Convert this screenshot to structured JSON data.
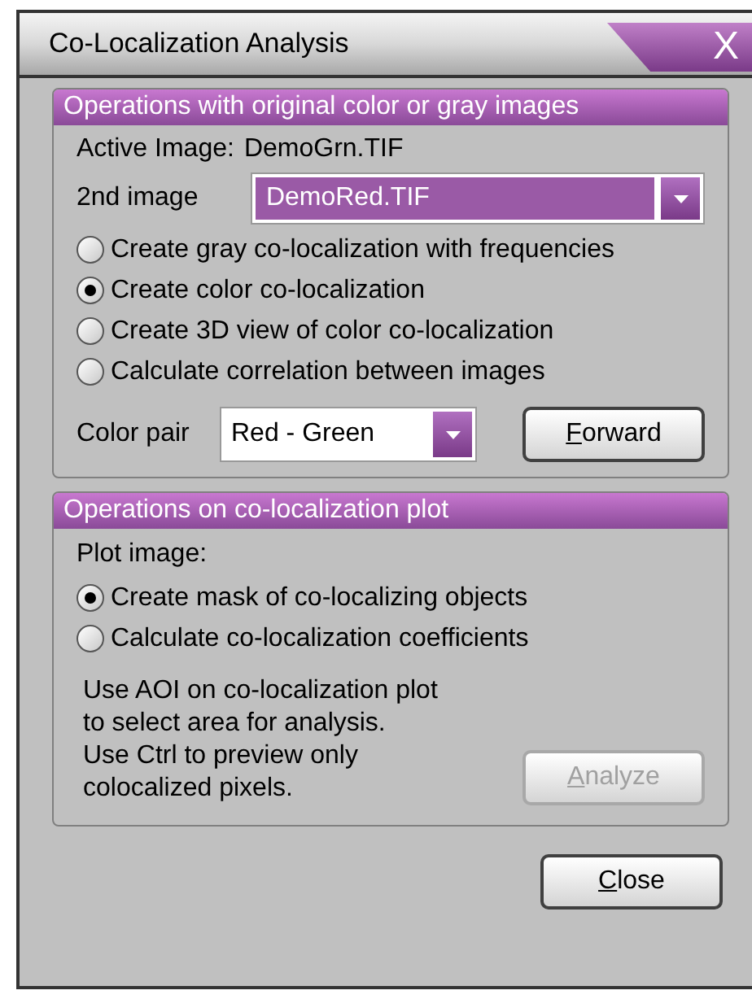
{
  "window": {
    "title": "Co-Localization Analysis",
    "close_glyph": "X"
  },
  "original_group": {
    "header": "Operations with original color or gray images",
    "active_image": {
      "label": "Active Image:",
      "value": "DemoGrn.TIF"
    },
    "second_image": {
      "label": "2nd image",
      "value": "DemoRed.TIF"
    },
    "options": [
      {
        "label": "Create gray co-localization with frequencies",
        "selected": false
      },
      {
        "label": "Create color co-localization",
        "selected": true
      },
      {
        "label": "Create 3D view of color co-localization",
        "selected": false
      },
      {
        "label": "Calculate correlation between images",
        "selected": false
      }
    ],
    "color_pair": {
      "label": "Color pair",
      "value": "Red - Green"
    },
    "button": {
      "label": "Forward",
      "access_key_underlined": true,
      "disabled": false
    }
  },
  "plot_group": {
    "header": "Operations on co-localization plot",
    "plot_label": "Plot image:",
    "options": [
      {
        "label": "Create mask of co-localizing objects",
        "selected": true
      },
      {
        "label": "Calculate co-localization coefficients",
        "selected": false
      }
    ],
    "hint": [
      "Use AOI on co-localization plot",
      "to select area for analysis.",
      "Use Ctrl  to preview only",
      "colocalized pixels."
    ],
    "button": {
      "label": "Analyze",
      "access_key_underlined": true,
      "disabled": true
    }
  },
  "close_button": {
    "label": "Close",
    "access_key_underlined": true,
    "disabled": false
  }
}
